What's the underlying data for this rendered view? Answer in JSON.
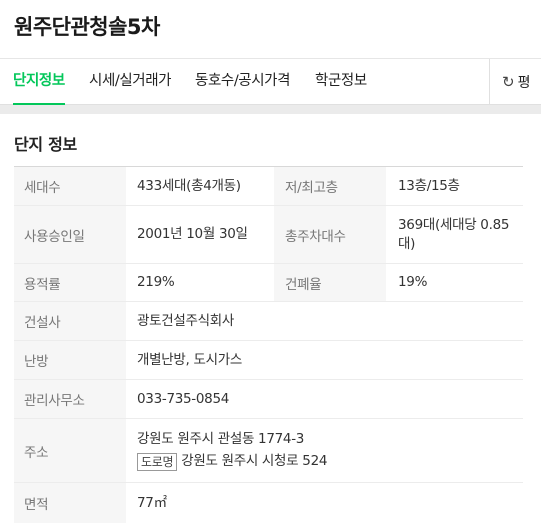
{
  "header": {
    "title": "원주단관청솔5차"
  },
  "tabs": [
    {
      "label": "단지정보",
      "active": true
    },
    {
      "label": "시세/실거래가",
      "active": false
    },
    {
      "label": "동호수/공시가격",
      "active": false
    },
    {
      "label": "학군정보",
      "active": false
    }
  ],
  "tab_more": {
    "icon": "refresh-icon",
    "label": "평"
  },
  "section": {
    "title": "단지 정보"
  },
  "colors": {
    "accent": "#03c75a"
  },
  "info": {
    "households_label": "세대수",
    "households_value": "433세대(총4개동)",
    "floors_label": "저/최고층",
    "floors_value": "13층/15층",
    "approval_label": "사용승인일",
    "approval_value": "2001년 10월 30일",
    "parking_label": "총주차대수",
    "parking_value": "369대(세대당 0.85대)",
    "far_label": "용적률",
    "far_value": "219%",
    "bcr_label": "건폐율",
    "bcr_value": "19%",
    "builder_label": "건설사",
    "builder_value": "광토건설주식회사",
    "heating_label": "난방",
    "heating_value": "개별난방, 도시가스",
    "office_label": "관리사무소",
    "office_value": "033-735-0854",
    "address_label": "주소",
    "address_lot": "강원도 원주시 관설동 1774-3",
    "road_badge": "도로명",
    "address_road": "강원도 원주시 시청로 524",
    "area_label": "면적",
    "area_value": "77㎡"
  }
}
